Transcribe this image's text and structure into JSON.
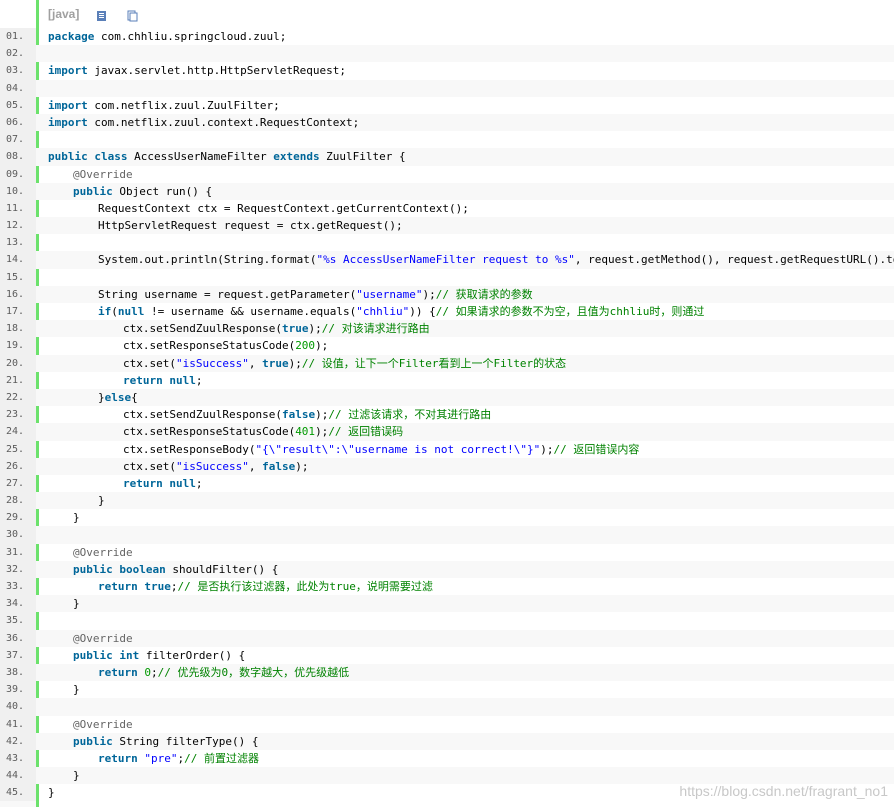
{
  "toolbar": {
    "lang_label": "[java]",
    "copy_icon": "document-icon",
    "print_icon": "clipboard-icon"
  },
  "watermark": "https://blog.csdn.net/fragrant_no1",
  "colors": {
    "keyword": "#006699",
    "string": "#0000ff",
    "comment": "#008200",
    "number": "#009900",
    "gutter_bar": "#6ce26c"
  },
  "lines": [
    {
      "n": "01.",
      "tokens": [
        [
          "kw",
          "package"
        ],
        [
          "t",
          " com.chhliu.springcloud.zuul;"
        ]
      ]
    },
    {
      "n": "02.",
      "tokens": []
    },
    {
      "n": "03.",
      "tokens": [
        [
          "kw",
          "import"
        ],
        [
          "t",
          " javax.servlet.http.HttpServletRequest;"
        ]
      ]
    },
    {
      "n": "04.",
      "tokens": []
    },
    {
      "n": "05.",
      "tokens": [
        [
          "kw",
          "import"
        ],
        [
          "t",
          " com.netflix.zuul.ZuulFilter;"
        ]
      ]
    },
    {
      "n": "06.",
      "tokens": [
        [
          "kw",
          "import"
        ],
        [
          "t",
          " com.netflix.zuul.context.RequestContext;"
        ]
      ]
    },
    {
      "n": "07.",
      "tokens": []
    },
    {
      "n": "08.",
      "tokens": [
        [
          "kw",
          "public"
        ],
        [
          "t",
          " "
        ],
        [
          "kw",
          "class"
        ],
        [
          "t",
          " AccessUserNameFilter "
        ],
        [
          "kw",
          "extends"
        ],
        [
          "t",
          " ZuulFilter {"
        ]
      ]
    },
    {
      "n": "09.",
      "indent": 1,
      "tokens": [
        [
          "an",
          "@Override"
        ]
      ]
    },
    {
      "n": "10.",
      "indent": 1,
      "tokens": [
        [
          "kw",
          "public"
        ],
        [
          "t",
          " Object run() {"
        ]
      ]
    },
    {
      "n": "11.",
      "indent": 2,
      "tokens": [
        [
          "t",
          "RequestContext ctx = RequestContext.getCurrentContext();"
        ]
      ]
    },
    {
      "n": "12.",
      "indent": 2,
      "tokens": [
        [
          "t",
          "HttpServletRequest request = ctx.getRequest();"
        ]
      ]
    },
    {
      "n": "13.",
      "tokens": []
    },
    {
      "n": "14.",
      "indent": 2,
      "tokens": [
        [
          "t",
          "System.out.println(String.format("
        ],
        [
          "str",
          "\"%s AccessUserNameFilter request to %s\""
        ],
        [
          "t",
          ", request.getMethod(), request.getRequestURL().toString()));"
        ]
      ]
    },
    {
      "n": "15.",
      "tokens": []
    },
    {
      "n": "16.",
      "indent": 2,
      "tokens": [
        [
          "t",
          "String username = request.getParameter("
        ],
        [
          "str",
          "\"username\""
        ],
        [
          "t",
          ");"
        ],
        [
          "cm",
          "// 获取请求的参数"
        ]
      ]
    },
    {
      "n": "17.",
      "indent": 2,
      "tokens": [
        [
          "kw",
          "if"
        ],
        [
          "t",
          "("
        ],
        [
          "kw",
          "null"
        ],
        [
          "t",
          " != username && username.equals("
        ],
        [
          "str",
          "\"chhliu\""
        ],
        [
          "t",
          ")) {"
        ],
        [
          "cm",
          "// 如果请求的参数不为空，且值为chhliu时，则通过"
        ]
      ]
    },
    {
      "n": "18.",
      "indent": 3,
      "tokens": [
        [
          "t",
          "ctx.setSendZuulResponse("
        ],
        [
          "kw",
          "true"
        ],
        [
          "t",
          ");"
        ],
        [
          "cm",
          "// 对该请求进行路由"
        ]
      ]
    },
    {
      "n": "19.",
      "indent": 3,
      "tokens": [
        [
          "t",
          "ctx.setResponseStatusCode("
        ],
        [
          "num",
          "200"
        ],
        [
          "t",
          ");"
        ]
      ]
    },
    {
      "n": "20.",
      "indent": 3,
      "tokens": [
        [
          "t",
          "ctx.set("
        ],
        [
          "str",
          "\"isSuccess\""
        ],
        [
          "t",
          ", "
        ],
        [
          "kw",
          "true"
        ],
        [
          "t",
          ");"
        ],
        [
          "cm",
          "// 设值，让下一个Filter看到上一个Filter的状态"
        ]
      ]
    },
    {
      "n": "21.",
      "indent": 3,
      "tokens": [
        [
          "kw",
          "return"
        ],
        [
          "t",
          " "
        ],
        [
          "kw",
          "null"
        ],
        [
          "t",
          ";"
        ]
      ]
    },
    {
      "n": "22.",
      "indent": 2,
      "tokens": [
        [
          "t",
          "}"
        ],
        [
          "kw",
          "else"
        ],
        [
          "t",
          "{"
        ]
      ]
    },
    {
      "n": "23.",
      "indent": 3,
      "tokens": [
        [
          "t",
          "ctx.setSendZuulResponse("
        ],
        [
          "kw",
          "false"
        ],
        [
          "t",
          ");"
        ],
        [
          "cm",
          "// 过滤该请求，不对其进行路由"
        ]
      ]
    },
    {
      "n": "24.",
      "indent": 3,
      "tokens": [
        [
          "t",
          "ctx.setResponseStatusCode("
        ],
        [
          "num",
          "401"
        ],
        [
          "t",
          ");"
        ],
        [
          "cm",
          "// 返回错误码"
        ]
      ]
    },
    {
      "n": "25.",
      "indent": 3,
      "tokens": [
        [
          "t",
          "ctx.setResponseBody("
        ],
        [
          "str",
          "\"{\\\"result\\\":\\\"username is not correct!\\\"}\""
        ],
        [
          "t",
          ");"
        ],
        [
          "cm",
          "// 返回错误内容"
        ]
      ]
    },
    {
      "n": "26.",
      "indent": 3,
      "tokens": [
        [
          "t",
          "ctx.set("
        ],
        [
          "str",
          "\"isSuccess\""
        ],
        [
          "t",
          ", "
        ],
        [
          "kw",
          "false"
        ],
        [
          "t",
          ");"
        ]
      ]
    },
    {
      "n": "27.",
      "indent": 3,
      "tokens": [
        [
          "kw",
          "return"
        ],
        [
          "t",
          " "
        ],
        [
          "kw",
          "null"
        ],
        [
          "t",
          ";"
        ]
      ]
    },
    {
      "n": "28.",
      "indent": 2,
      "tokens": [
        [
          "t",
          "}"
        ]
      ]
    },
    {
      "n": "29.",
      "indent": 1,
      "tokens": [
        [
          "t",
          "}"
        ]
      ]
    },
    {
      "n": "30.",
      "tokens": []
    },
    {
      "n": "31.",
      "indent": 1,
      "tokens": [
        [
          "an",
          "@Override"
        ]
      ]
    },
    {
      "n": "32.",
      "indent": 1,
      "tokens": [
        [
          "kw",
          "public"
        ],
        [
          "t",
          " "
        ],
        [
          "kw",
          "boolean"
        ],
        [
          "t",
          " shouldFilter() {"
        ]
      ]
    },
    {
      "n": "33.",
      "indent": 2,
      "tokens": [
        [
          "kw",
          "return"
        ],
        [
          "t",
          " "
        ],
        [
          "kw",
          "true"
        ],
        [
          "t",
          ";"
        ],
        [
          "cm",
          "// 是否执行该过滤器，此处为true，说明需要过滤"
        ]
      ]
    },
    {
      "n": "34.",
      "indent": 1,
      "tokens": [
        [
          "t",
          "}"
        ]
      ]
    },
    {
      "n": "35.",
      "tokens": []
    },
    {
      "n": "36.",
      "indent": 1,
      "tokens": [
        [
          "an",
          "@Override"
        ]
      ]
    },
    {
      "n": "37.",
      "indent": 1,
      "tokens": [
        [
          "kw",
          "public"
        ],
        [
          "t",
          " "
        ],
        [
          "kw",
          "int"
        ],
        [
          "t",
          " filterOrder() {"
        ]
      ]
    },
    {
      "n": "38.",
      "indent": 2,
      "tokens": [
        [
          "kw",
          "return"
        ],
        [
          "t",
          " "
        ],
        [
          "num",
          "0"
        ],
        [
          "t",
          ";"
        ],
        [
          "cm",
          "// 优先级为0，数字越大，优先级越低"
        ]
      ]
    },
    {
      "n": "39.",
      "indent": 1,
      "tokens": [
        [
          "t",
          "}"
        ]
      ]
    },
    {
      "n": "40.",
      "tokens": []
    },
    {
      "n": "41.",
      "indent": 1,
      "tokens": [
        [
          "an",
          "@Override"
        ]
      ]
    },
    {
      "n": "42.",
      "indent": 1,
      "tokens": [
        [
          "kw",
          "public"
        ],
        [
          "t",
          " String filterType() {"
        ]
      ]
    },
    {
      "n": "43.",
      "indent": 2,
      "tokens": [
        [
          "kw",
          "return"
        ],
        [
          "t",
          " "
        ],
        [
          "str",
          "\"pre\""
        ],
        [
          "t",
          ";"
        ],
        [
          "cm",
          "// 前置过滤器"
        ]
      ]
    },
    {
      "n": "44.",
      "indent": 1,
      "tokens": [
        [
          "t",
          "}"
        ]
      ]
    },
    {
      "n": "45.",
      "tokens": [
        [
          "t",
          "}"
        ]
      ]
    }
  ]
}
